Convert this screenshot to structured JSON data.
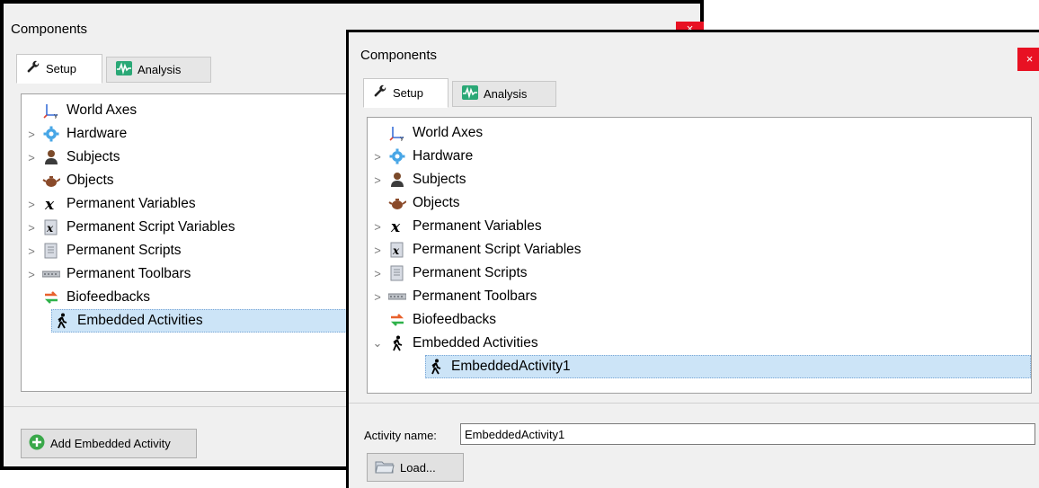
{
  "back_window": {
    "title": "Components",
    "close_glyph": "×",
    "tabs": [
      {
        "label": "Setup",
        "icon": "wrench-icon",
        "active": true
      },
      {
        "label": "Analysis",
        "icon": "waveform-icon",
        "active": false
      }
    ],
    "tree": [
      {
        "label": "World Axes",
        "icon": "axes-icon",
        "expandable": false
      },
      {
        "label": "Hardware",
        "icon": "gear-icon",
        "expandable": true
      },
      {
        "label": "Subjects",
        "icon": "person-icon",
        "expandable": true
      },
      {
        "label": "Objects",
        "icon": "teapot-icon",
        "expandable": false
      },
      {
        "label": "Permanent Variables",
        "icon": "variable-x-icon",
        "expandable": true
      },
      {
        "label": "Permanent Script Variables",
        "icon": "script-variable-icon",
        "expandable": true
      },
      {
        "label": "Permanent Scripts",
        "icon": "script-icon",
        "expandable": true
      },
      {
        "label": "Permanent Toolbars",
        "icon": "toolbar-icon",
        "expandable": true
      },
      {
        "label": "Biofeedbacks",
        "icon": "biofeedback-icon",
        "expandable": false
      },
      {
        "label": "Embedded Activities",
        "icon": "walking-icon",
        "expandable": false,
        "selected": true
      }
    ],
    "add_button": "Add Embedded Activity"
  },
  "front_window": {
    "title": "Components",
    "close_glyph": "×",
    "tabs": [
      {
        "label": "Setup",
        "icon": "wrench-icon",
        "active": true
      },
      {
        "label": "Analysis",
        "icon": "waveform-icon",
        "active": false
      }
    ],
    "tree": [
      {
        "label": "World Axes",
        "icon": "axes-icon",
        "expandable": false
      },
      {
        "label": "Hardware",
        "icon": "gear-icon",
        "expandable": true
      },
      {
        "label": "Subjects",
        "icon": "person-icon",
        "expandable": true
      },
      {
        "label": "Objects",
        "icon": "teapot-icon",
        "expandable": false
      },
      {
        "label": "Permanent Variables",
        "icon": "variable-x-icon",
        "expandable": true
      },
      {
        "label": "Permanent Script Variables",
        "icon": "script-variable-icon",
        "expandable": true
      },
      {
        "label": "Permanent Scripts",
        "icon": "script-icon",
        "expandable": true
      },
      {
        "label": "Permanent Toolbars",
        "icon": "toolbar-icon",
        "expandable": true
      },
      {
        "label": "Biofeedbacks",
        "icon": "biofeedback-icon",
        "expandable": false
      },
      {
        "label": "Embedded Activities",
        "icon": "walking-icon",
        "expandable": true,
        "expanded": true
      },
      {
        "label": "EmbeddedActivity1",
        "icon": "walking-icon",
        "child": true,
        "selected": true
      }
    ],
    "activity_name_label": "Activity name:",
    "activity_name_value": "EmbeddedActivity1",
    "load_button": "Load..."
  },
  "colors": {
    "selection": "#cce4f7",
    "close_button": "#e81123",
    "window_bg": "#f0f0f0"
  }
}
